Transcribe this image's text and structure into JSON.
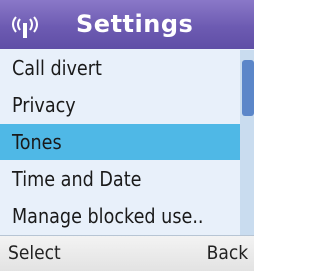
{
  "header": {
    "title": "Settings",
    "icon": "signal-icon"
  },
  "menu": {
    "items": [
      {
        "label": "Call divert",
        "selected": false
      },
      {
        "label": "Privacy",
        "selected": false
      },
      {
        "label": "Tones",
        "selected": true
      },
      {
        "label": "Time and Date",
        "selected": false
      },
      {
        "label": "Manage blocked use..",
        "selected": false
      }
    ]
  },
  "softkeys": {
    "left": "Select",
    "right": "Back"
  },
  "colors": {
    "header": "#6d5bb2",
    "selection": "#4fb8e6",
    "list_background": "#e8f0fa"
  }
}
